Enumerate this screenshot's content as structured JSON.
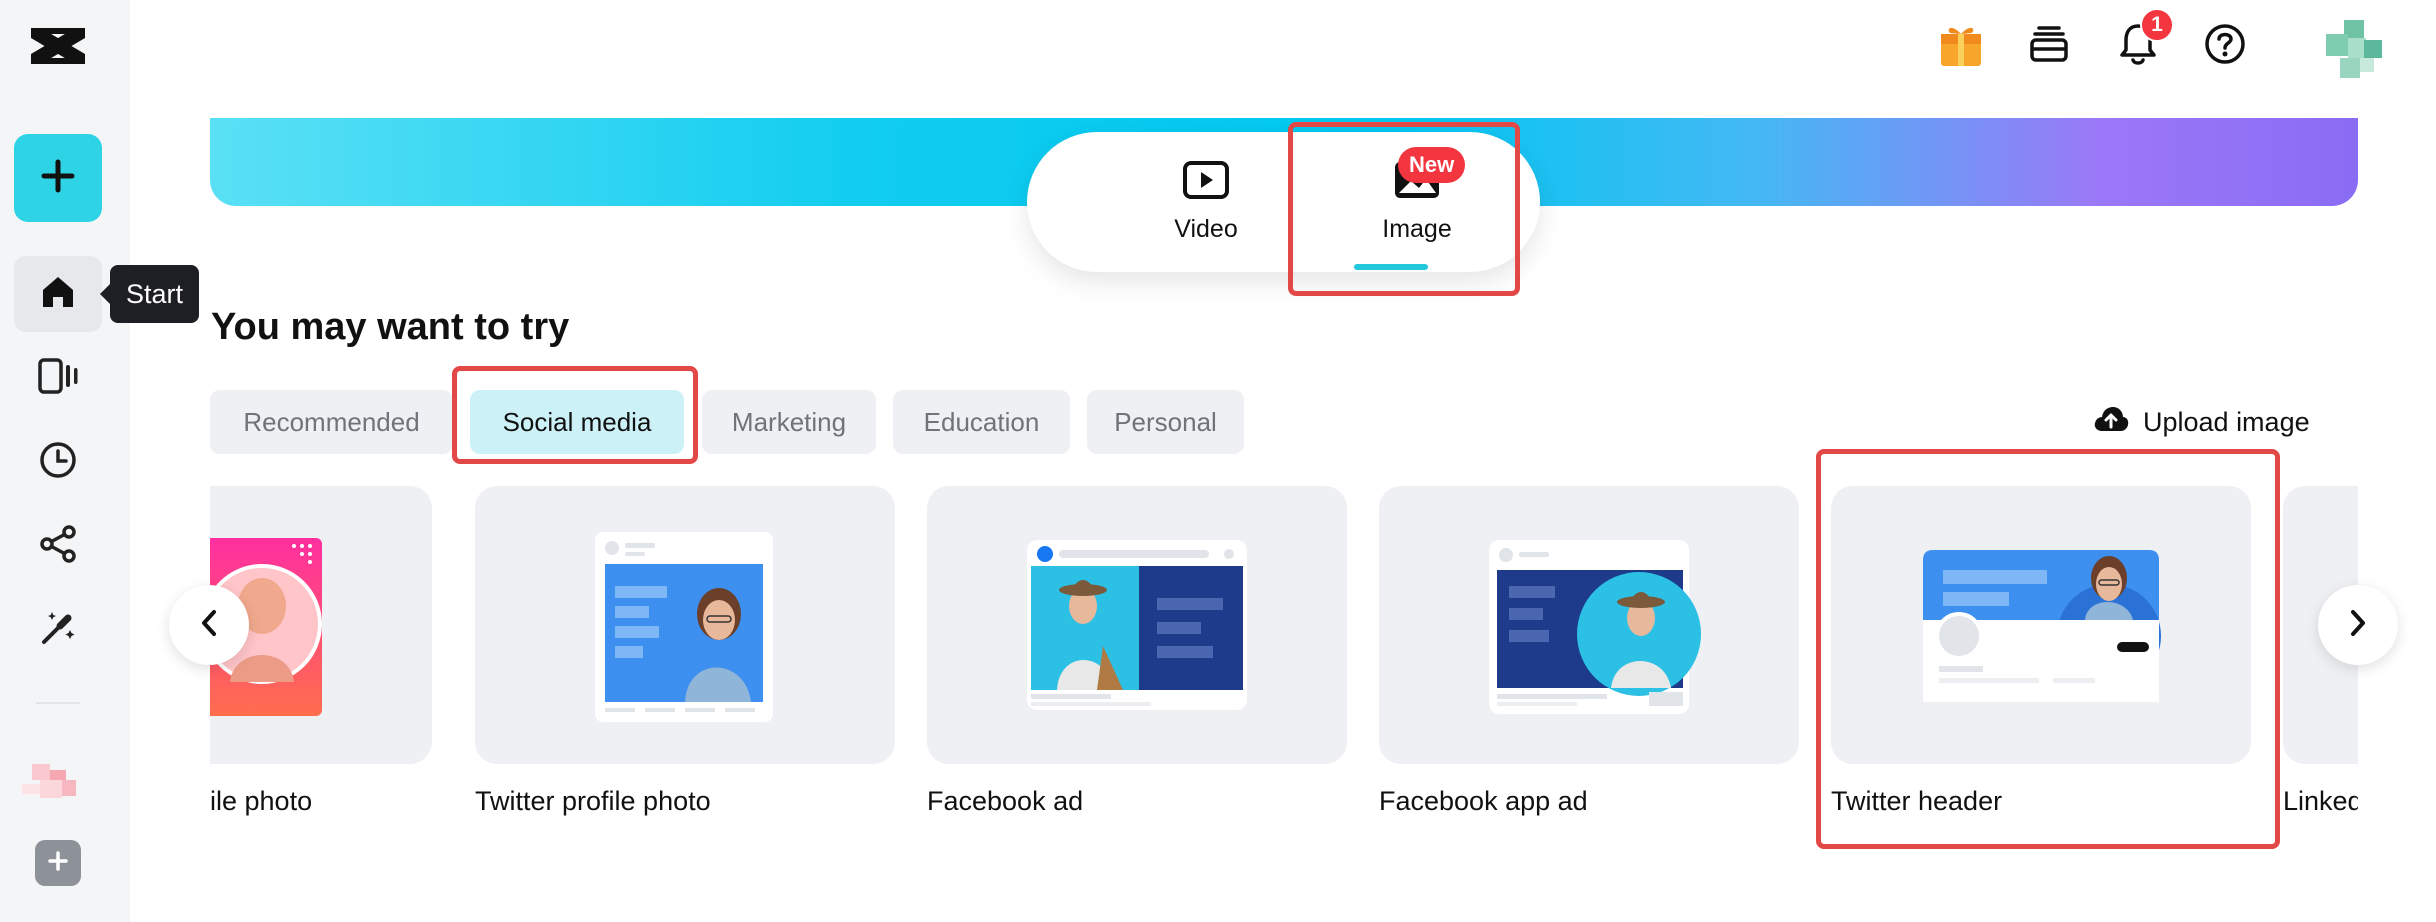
{
  "sidebar": {
    "logo_icon": "capcut-logo-icon",
    "create_icon": "plus-icon",
    "items": [
      {
        "name": "home",
        "icon": "home-icon",
        "active": true
      },
      {
        "name": "templates",
        "icon": "video-panels-icon",
        "active": false
      },
      {
        "name": "recent",
        "icon": "clock-icon",
        "active": false
      },
      {
        "name": "shared",
        "icon": "share-icon",
        "active": false
      },
      {
        "name": "magic-tools",
        "icon": "magic-wand-icon",
        "active": false
      }
    ],
    "add_icon": "plus-icon"
  },
  "tooltip": {
    "text": "Start"
  },
  "header": {
    "icons": [
      "gift-icon",
      "layers-icon",
      "bell-icon",
      "help-icon"
    ],
    "notification_count": "1"
  },
  "switcher": {
    "tabs": [
      {
        "label": "Video",
        "icon": "play-icon",
        "active": false
      },
      {
        "label": "Image",
        "icon": "image-icon",
        "active": true
      }
    ],
    "new_badge": "New"
  },
  "section": {
    "title": "You may want to try",
    "filters": [
      {
        "label": "Recommended",
        "active": false
      },
      {
        "label": "Social media",
        "active": true
      },
      {
        "label": "Marketing",
        "active": false
      },
      {
        "label": "Education",
        "active": false
      },
      {
        "label": "Personal",
        "active": false
      }
    ],
    "upload_label": "Upload image"
  },
  "cards": [
    {
      "label": "ile photo"
    },
    {
      "label": "Twitter profile photo"
    },
    {
      "label": "Facebook ad"
    },
    {
      "label": "Facebook app ad"
    },
    {
      "label": "Twitter header"
    },
    {
      "label": "Linked"
    }
  ],
  "colors": {
    "accent": "#2ed3e6",
    "highlight": "#e24846",
    "badge": "#f2353f",
    "facebook_blue": "#1e3a8a",
    "twitter_blue": "#3d8ff0"
  }
}
